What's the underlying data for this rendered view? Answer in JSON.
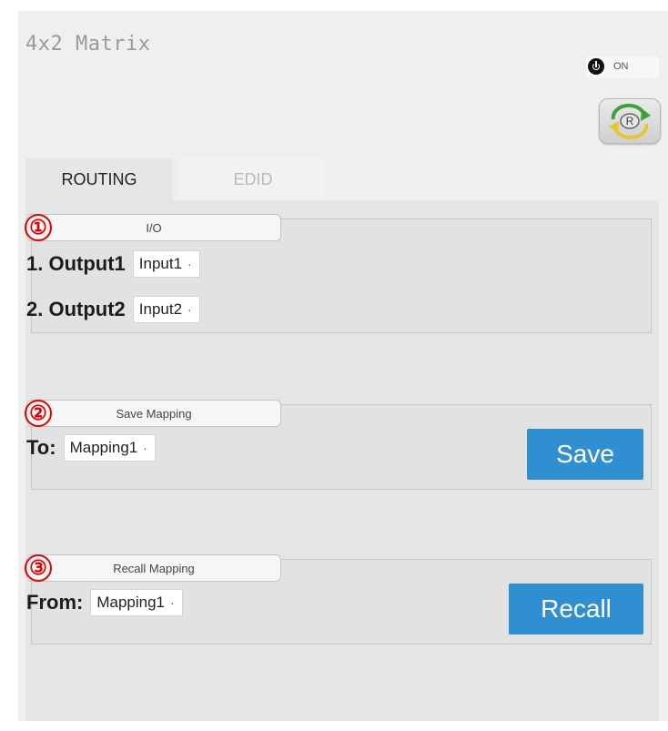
{
  "app": {
    "title": "4x2 Matrix"
  },
  "power": {
    "label": "ON",
    "icon": "power-icon"
  },
  "refresh": {
    "label": "R",
    "icon": "refresh-icon"
  },
  "tabs": [
    {
      "label": "ROUTING",
      "active": true
    },
    {
      "label": "EDID",
      "active": false
    }
  ],
  "io": {
    "marker": "①",
    "legend": "I/O",
    "rows": [
      {
        "label": "1. Output1",
        "value": "Input1"
      },
      {
        "label": "2. Output2",
        "value": "Input2"
      }
    ]
  },
  "save_mapping": {
    "marker": "②",
    "legend": "Save Mapping",
    "label": "To:",
    "value": "Mapping1",
    "button": "Save"
  },
  "recall_mapping": {
    "marker": "③",
    "legend": "Recall Mapping",
    "label": "From:",
    "value": "Mapping1",
    "button": "Recall"
  },
  "colors": {
    "accent": "#2f8fd1",
    "marker": "#e60000",
    "panel": "#efefef"
  }
}
